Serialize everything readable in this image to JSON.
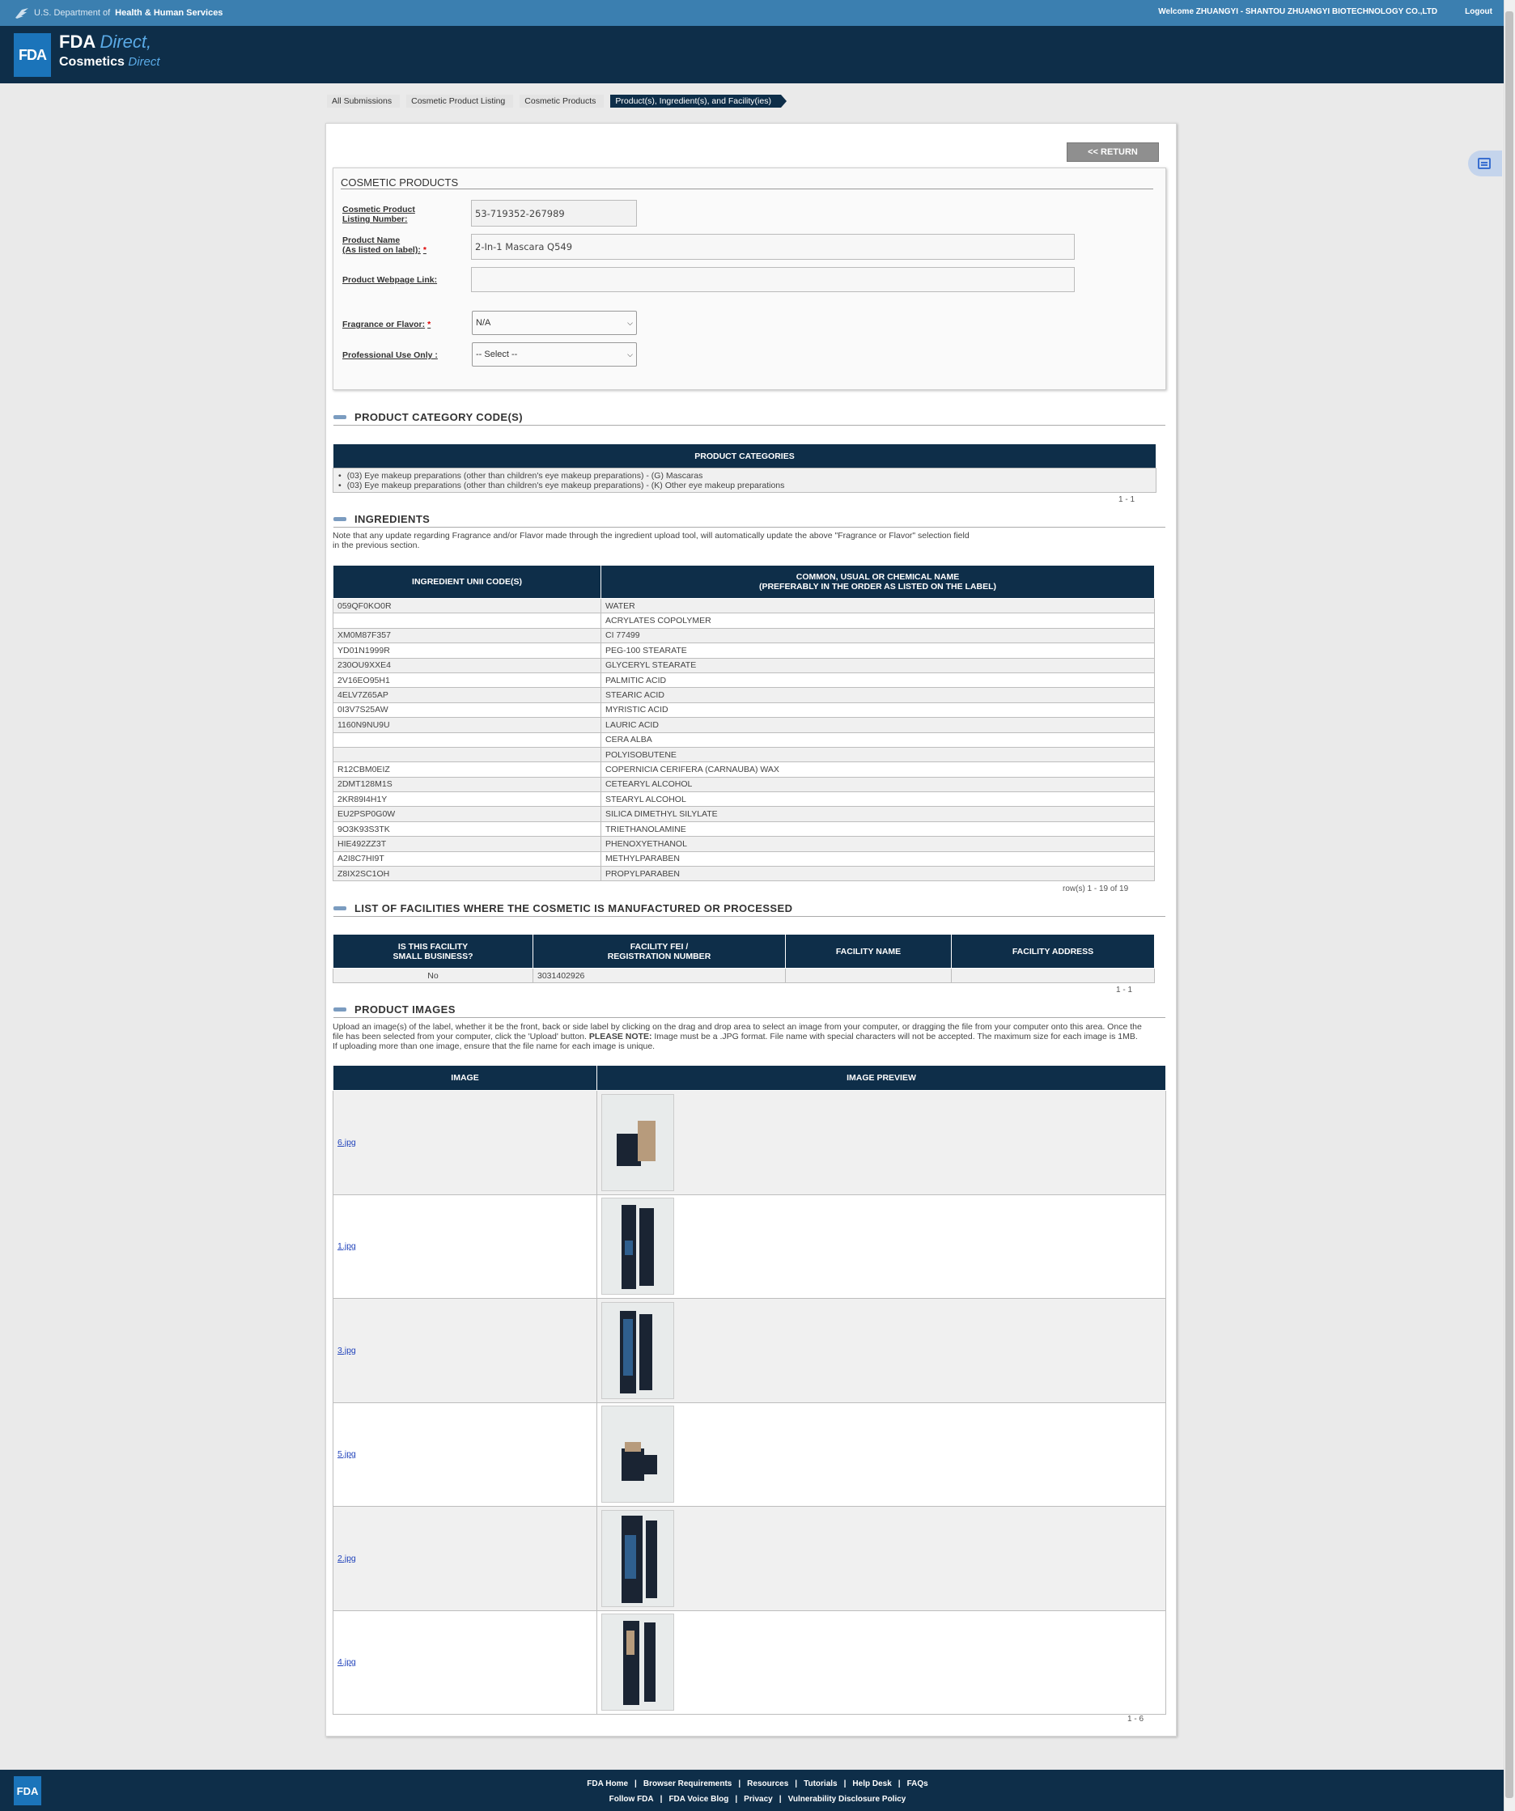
{
  "topbar": {
    "dept_prefix": "U.S. Department of",
    "dept_name": "Health & Human Services",
    "welcome": "Welcome ZHUANGYI - SHANTOU ZHUANGYI BIOTECHNOLOGY CO.,LTD",
    "logout": "Logout"
  },
  "header": {
    "logo": "FDA",
    "brand_main": "FDA",
    "brand_main_italic": "Direct,",
    "brand_sub": "Cosmetics",
    "brand_sub_italic": "Direct"
  },
  "breadcrumb": [
    "All Submissions",
    "Cosmetic Product Listing",
    "Cosmetic Products",
    "Product(s), Ingredient(s), and Facility(ies)"
  ],
  "return_button": "<< RETURN",
  "cosmetic_products": {
    "title": "COSMETIC PRODUCTS",
    "listing_number_label_1": "Cosmetic Product",
    "listing_number_label_2": "Listing Number:",
    "listing_number_value": "53-719352-267989",
    "product_name_label_1": "Product Name",
    "product_name_label_2": "(As listed on label):",
    "product_name_value": "2-In-1 Mascara Q549",
    "webpage_label": "Product Webpage Link:",
    "webpage_value": "",
    "fragrance_label": "Fragrance or Flavor:",
    "fragrance_value": "N/A",
    "professional_label": "Professional Use Only :",
    "professional_value": "-- Select --",
    "required_mark": "*"
  },
  "categories": {
    "heading": "PRODUCT CATEGORY CODE(S)",
    "table_header": "PRODUCT CATEGORIES",
    "items": [
      "(03) Eye makeup preparations (other than children's eye makeup preparations) - (G) Mascaras",
      "(03) Eye makeup preparations (other than children's eye makeup preparations) - (K) Other eye makeup preparations"
    ],
    "pager": "1 - 1"
  },
  "ingredients": {
    "heading": "INGREDIENTS",
    "note_line1": "Note that any update regarding Fragrance and/or Flavor made through the ingredient upload tool, will automatically update the above \"Fragrance or Flavor\" selection field",
    "note_line2": "in the previous section.",
    "col1": "INGREDIENT UNII CODE(S)",
    "col2_line1": "COMMON, USUAL OR CHEMICAL NAME",
    "col2_line2": "(PREFERABLY IN THE ORDER AS LISTED ON THE LABEL)",
    "rows": [
      {
        "code": "059QF0KO0R",
        "name": "WATER"
      },
      {
        "code": "",
        "name": "ACRYLATES COPOLYMER"
      },
      {
        "code": "XM0M87F357",
        "name": "CI 77499"
      },
      {
        "code": "YD01N1999R",
        "name": "PEG-100 STEARATE"
      },
      {
        "code": "230OU9XXE4",
        "name": "GLYCERYL STEARATE"
      },
      {
        "code": "2V16EO95H1",
        "name": "PALMITIC ACID"
      },
      {
        "code": "4ELV7Z65AP",
        "name": "STEARIC ACID"
      },
      {
        "code": "0I3V7S25AW",
        "name": "MYRISTIC ACID"
      },
      {
        "code": "1160N9NU9U",
        "name": "LAURIC ACID"
      },
      {
        "code": "",
        "name": "CERA ALBA"
      },
      {
        "code": "",
        "name": "POLYISOBUTENE"
      },
      {
        "code": "R12CBM0EIZ",
        "name": "COPERNICIA CERIFERA (CARNAUBA) WAX"
      },
      {
        "code": "2DMT128M1S",
        "name": "CETEARYL ALCOHOL"
      },
      {
        "code": "2KR89I4H1Y",
        "name": "STEARYL ALCOHOL"
      },
      {
        "code": "EU2PSP0G0W",
        "name": "SILICA DIMETHYL SILYLATE"
      },
      {
        "code": "9O3K93S3TK",
        "name": "TRIETHANOLAMINE"
      },
      {
        "code": "HIE492ZZ3T",
        "name": "PHENOXYETHANOL"
      },
      {
        "code": "A2I8C7HI9T",
        "name": "METHYLPARABEN"
      },
      {
        "code": "Z8IX2SC1OH",
        "name": "PROPYLPARABEN"
      }
    ],
    "pager": "row(s) 1 - 19 of 19"
  },
  "facilities": {
    "heading": "LIST OF FACILITIES WHERE THE COSMETIC IS MANUFACTURED OR PROCESSED",
    "col1_line1": "IS THIS FACILITY",
    "col1_line2": "SMALL BUSINESS?",
    "col2_line1": "FACILITY FEI /",
    "col2_line2": "REGISTRATION NUMBER",
    "col3": "FACILITY NAME",
    "col4": "FACILITY ADDRESS",
    "rows": [
      {
        "small_business": "No",
        "fei": "3031402926",
        "name": "",
        "address": ""
      }
    ],
    "pager": "1 - 1"
  },
  "images": {
    "heading": "PRODUCT IMAGES",
    "note_line1": "Upload an image(s) of the label, whether it be the front, back or side label by clicking on the drag and drop area to select an image from your computer, or dragging the file from your computer onto this area. Once the",
    "note_line2_a": "file has been selected from your computer, click the 'Upload' button.",
    "note_line2_b": "PLEASE NOTE:",
    "note_line2_c": "Image must be a .JPG format. File name with special characters will not be accepted. The maximum size for each image is 1MB.",
    "note_line3": "If uploading more than one image, ensure that the file name for each image is unique.",
    "col1": "IMAGE",
    "col2": "IMAGE PREVIEW",
    "files": [
      "6.jpg",
      "1.jpg",
      "3.jpg",
      "5.jpg",
      "2.jpg",
      "4.jpg"
    ],
    "pager": "1 - 6"
  },
  "footer": {
    "logo": "FDA",
    "row1": [
      "FDA Home",
      "Browser Requirements",
      "Resources",
      "Tutorials",
      "Help Desk",
      "FAQs"
    ],
    "row2": [
      "Follow FDA",
      "FDA Voice Blog",
      "Privacy",
      "Vulnerability Disclosure Policy"
    ]
  },
  "colors": {
    "header_navy": "#0e2e49",
    "hhs_blue": "#3b7fb0",
    "fda_blue": "#1b74ba"
  }
}
